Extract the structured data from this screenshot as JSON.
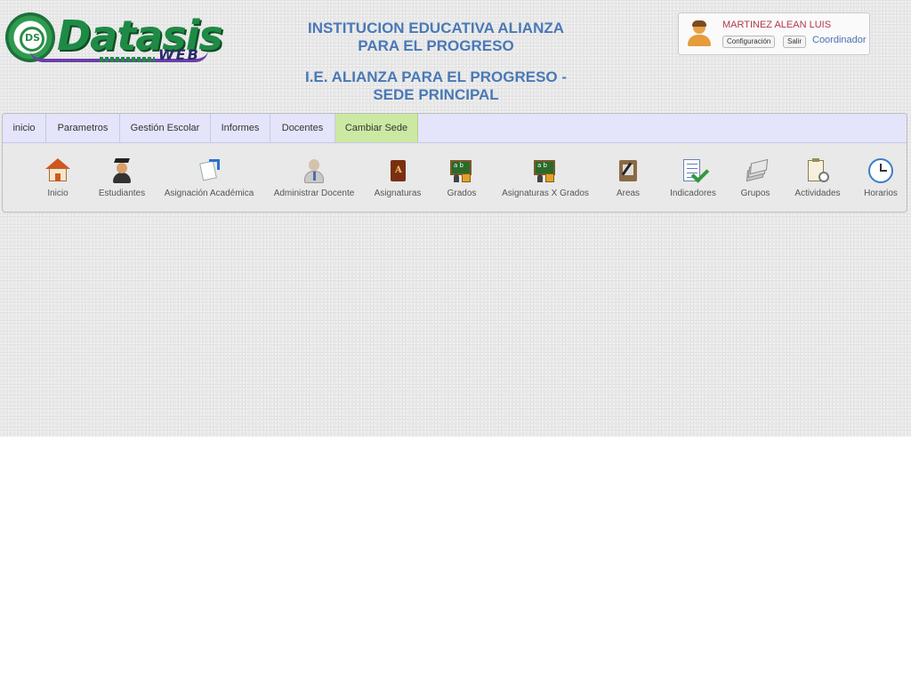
{
  "header": {
    "logo_text": "Datasis",
    "logo_subtext": "WEB",
    "logo_badge": "DS",
    "institution_name": "INSTITUCION EDUCATIVA ALIANZA PARA EL PROGRESO",
    "institution_line1": "INSTITUCION EDUCATIVA ALIANZA",
    "institution_line2": "PARA EL PROGRESO",
    "site_line1": "I.E. ALIANZA PARA EL PROGRESO -",
    "site_line2": "SEDE PRINCIPAL"
  },
  "user": {
    "name": "MARTINEZ ALEAN LUIS",
    "config_label": "Configuración",
    "logout_label": "Salir",
    "role": "Coordinador"
  },
  "tabs": [
    {
      "label": "inicio"
    },
    {
      "label": "Parametros"
    },
    {
      "label": "Gestión Escolar"
    },
    {
      "label": "Informes"
    },
    {
      "label": "Docentes"
    },
    {
      "label": "Cambiar Sede",
      "active": true
    }
  ],
  "toolbar": [
    {
      "label": "Inicio",
      "icon": "home-icon"
    },
    {
      "label": "Estudiantes",
      "icon": "student-icon"
    },
    {
      "label": "Asignación Académica",
      "icon": "academic-assignment-icon"
    },
    {
      "label": "Administrar Docente",
      "icon": "teacher-icon"
    },
    {
      "label": "Asignaturas",
      "icon": "book-icon"
    },
    {
      "label": "Grados",
      "icon": "chalkboard-icon"
    },
    {
      "label": "Asignaturas X Grados",
      "icon": "chalkboard-subjects-icon"
    },
    {
      "label": "Areas",
      "icon": "areas-icon"
    },
    {
      "label": "Indicadores",
      "icon": "checklist-icon"
    },
    {
      "label": "Grupos",
      "icon": "groups-icon"
    },
    {
      "label": "Actividades",
      "icon": "clipboard-icon"
    },
    {
      "label": "Horarios",
      "icon": "clock-icon"
    }
  ],
  "colors": {
    "title_blue": "#4a78b6",
    "username_red": "#b03a4a",
    "tab_bar": "#e4e4fb",
    "tab_active": "#cbe9a2",
    "logo_green": "#1f8a45"
  }
}
